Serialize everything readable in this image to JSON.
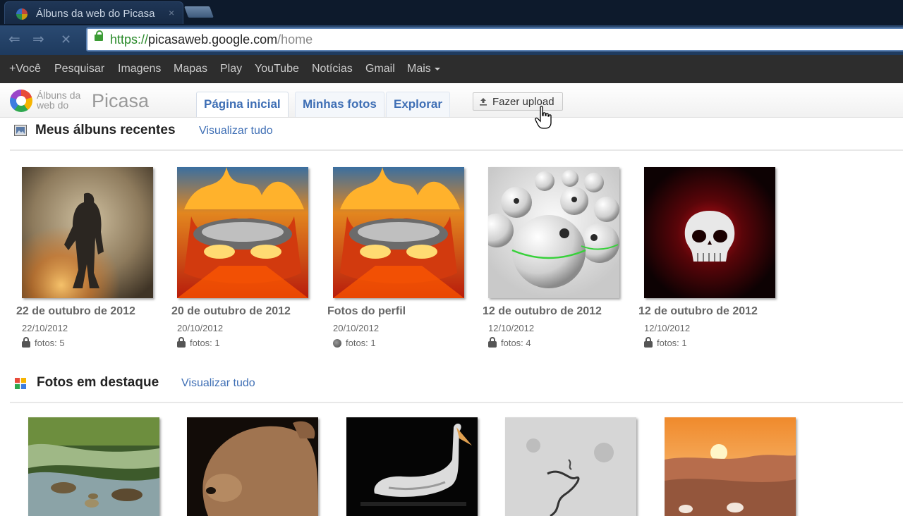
{
  "browser": {
    "tab_title": "Álbuns da web do Picasa",
    "tab_close": "×",
    "back": "⇐",
    "forward": "⇒",
    "stop": "✕",
    "url_scheme": "https://",
    "url_host": "picasaweb.google.com",
    "url_path": "/home"
  },
  "gbar": {
    "items": [
      "+Você",
      "Pesquisar",
      "Imagens",
      "Mapas",
      "Play",
      "YouTube",
      "Notícias",
      "Gmail",
      "Mais"
    ]
  },
  "picasa": {
    "logo_line1": "Álbuns da",
    "logo_line2": "web do",
    "brand": "Picasa",
    "tabs": [
      "Página inicial",
      "Minhas fotos",
      "Explorar"
    ],
    "upload_label": "Fazer upload"
  },
  "recent": {
    "title": "Meus álbuns recentes",
    "view_all": "Visualizar tudo",
    "albums": [
      {
        "title": "22 de outubro de 2012",
        "date": "22/10/2012",
        "count": "fotos: 5",
        "access": "private"
      },
      {
        "title": "20 de outubro de 2012",
        "date": "20/10/2012",
        "count": "fotos: 1",
        "access": "private"
      },
      {
        "title": "Fotos do perfil",
        "date": "20/10/2012",
        "count": "fotos: 1",
        "access": "public"
      },
      {
        "title": "12 de outubro de 2012",
        "date": "12/10/2012",
        "count": "fotos: 4",
        "access": "private"
      },
      {
        "title": "12 de outubro de 2012",
        "date": "12/10/2012",
        "count": "fotos: 1",
        "access": "private"
      }
    ]
  },
  "featured": {
    "title": "Fotos em destaque",
    "view_all": "Visualizar tudo"
  },
  "colors": {
    "link": "#3f6fb5",
    "gbar_bg": "#2d2d2d",
    "chrome_bg": "#1e3a5e"
  }
}
